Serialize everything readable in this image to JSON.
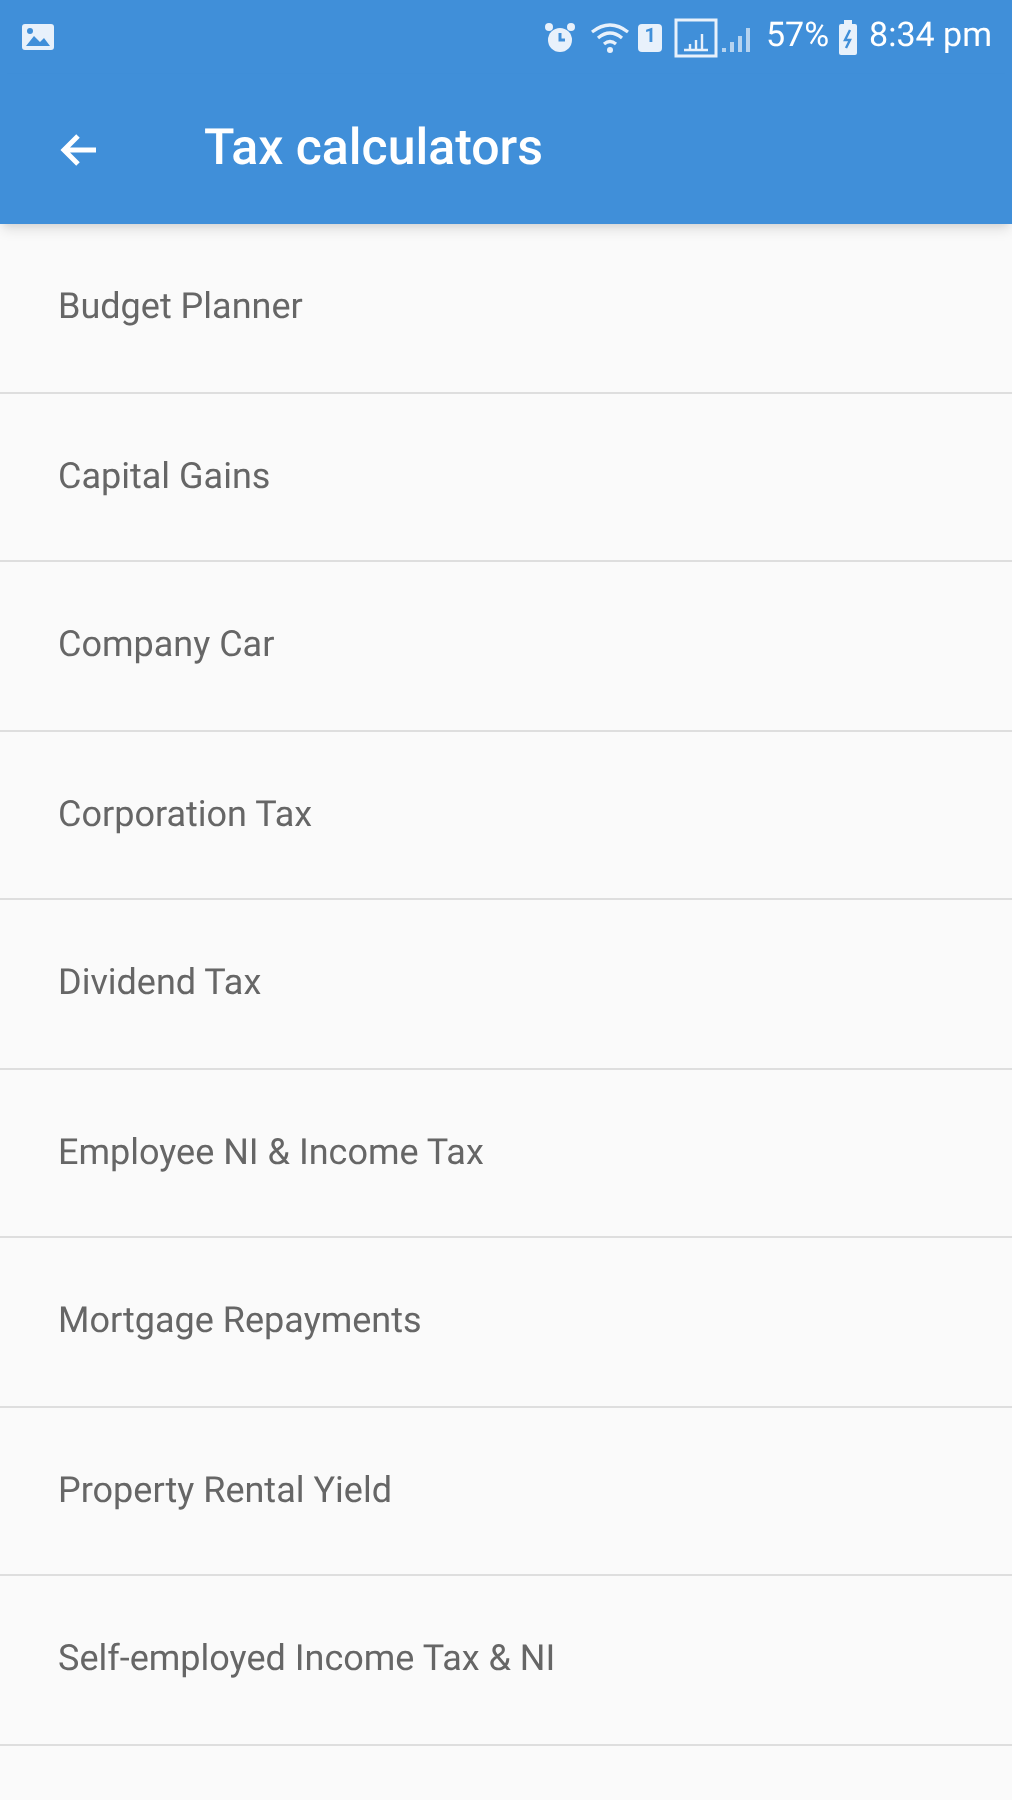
{
  "status_bar": {
    "sim": "1",
    "battery": "57%",
    "time": "8:34 pm"
  },
  "app_bar": {
    "title": "Tax calculators"
  },
  "items": [
    {
      "label": "Budget Planner"
    },
    {
      "label": "Capital Gains"
    },
    {
      "label": "Company Car"
    },
    {
      "label": "Corporation Tax"
    },
    {
      "label": "Dividend Tax"
    },
    {
      "label": "Employee NI & Income Tax"
    },
    {
      "label": "Mortgage Repayments"
    },
    {
      "label": "Property Rental Yield"
    },
    {
      "label": "Self-employed Income Tax & NI"
    }
  ]
}
